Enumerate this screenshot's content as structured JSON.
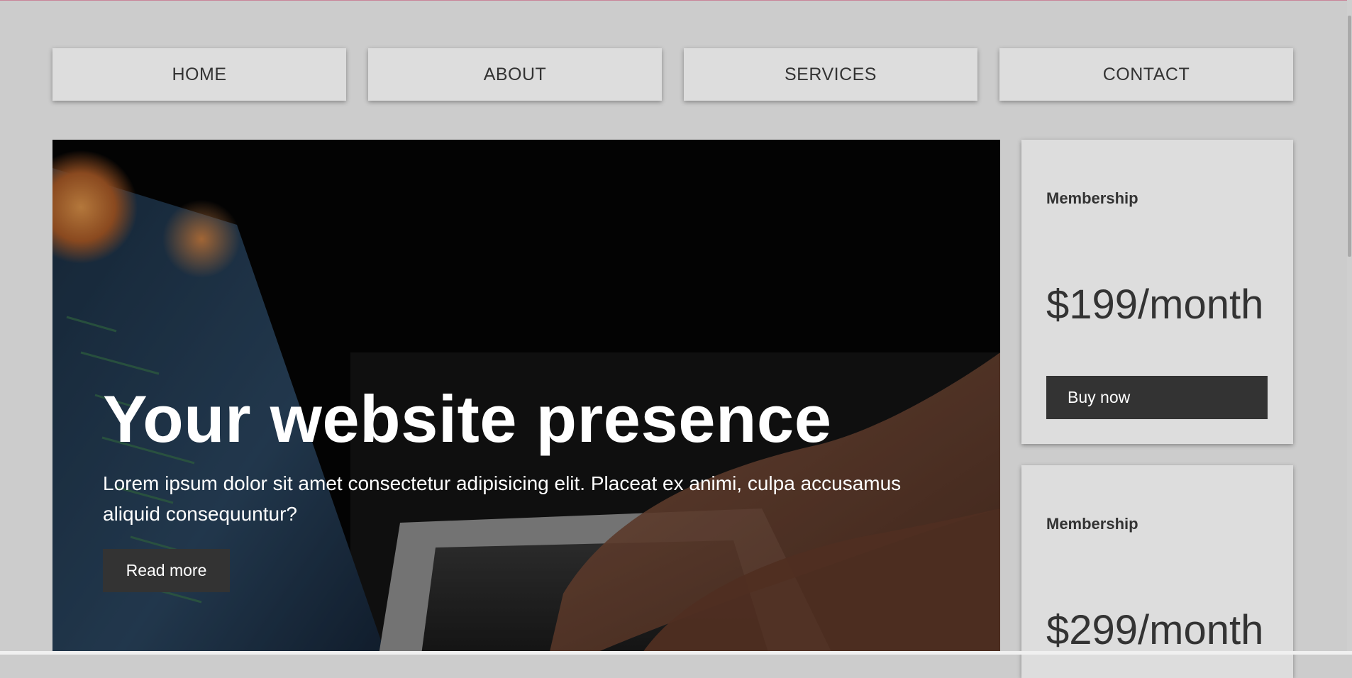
{
  "nav": {
    "items": [
      {
        "label": "HOME"
      },
      {
        "label": "ABOUT"
      },
      {
        "label": "SERVICES"
      },
      {
        "label": "CONTACT"
      }
    ]
  },
  "hero": {
    "title": "Your website presence",
    "description": "Lorem ipsum dolor sit amet consectetur adipisicing elit. Placeat ex animi, culpa accusamus aliquid consequuntur?",
    "button_label": "Read more"
  },
  "pricing": [
    {
      "title": "Membership",
      "price": "$199/month",
      "button_label": "Buy now"
    },
    {
      "title": "Membership",
      "price": "$299/month"
    }
  ],
  "colors": {
    "background": "#cccccc",
    "card": "#dddddd",
    "button": "#333333",
    "text": "#333333",
    "hero_text": "#ffffff"
  }
}
